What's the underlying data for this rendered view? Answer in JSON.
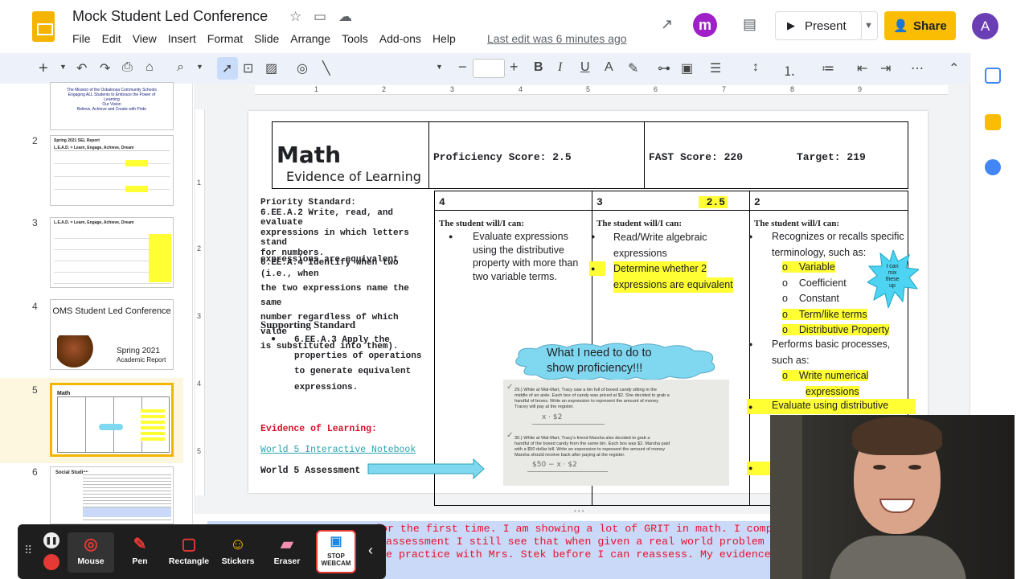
{
  "app": {
    "doc_title": "Mock Student Led Conference",
    "menu": [
      "File",
      "Edit",
      "View",
      "Insert",
      "Format",
      "Slide",
      "Arrange",
      "Tools",
      "Add-ons",
      "Help"
    ],
    "last_edit": "Last edit was 6 minutes ago",
    "present_label": "Present",
    "share_label": "Share",
    "avatar_initial": "A",
    "m_icon": "m"
  },
  "filmstrip": {
    "slides": [
      {
        "num": "",
        "lines": [
          "The Mission of the Oskaloosa Community Schools",
          "Engaging ALL Students to Embrace the Power of",
          "Learning",
          "Our Vision",
          "Believe, Achieve and Create with Pride"
        ]
      },
      {
        "num": "2",
        "title": "Spring 2021 SEL Report",
        "sub": "L.E.A.D. = Learn, Engage, Achieve, Dream"
      },
      {
        "num": "3",
        "title": "L.E.A.D. = Learn, Engage, Achieve, Dream"
      },
      {
        "num": "4",
        "title": "OMS Student Led Conference",
        "footer1": "Spring 2021",
        "footer2": "Academic Report"
      },
      {
        "num": "5",
        "title": "Math"
      },
      {
        "num": "6",
        "title": "Social Studies"
      }
    ]
  },
  "slide": {
    "title": "Math",
    "subtitle": "Evidence of Learning",
    "proficiency": "Proficiency Score: 2.5",
    "fast": "FAST Score:  220",
    "target": "Target:  219",
    "priority_header": "Priority Standard:",
    "priority_line1": "6.EE.A.2 Write, read, and evaluate",
    "priority_line2": "expressions in which letters stand",
    "priority_line3": "for numbers.",
    "priority_line4": "6.EE.A.4 Identify when two",
    "priority_line5": "expressions are equivalent (i.e., when",
    "priority_line6": "the two expressions name the same",
    "priority_line7": "number regardless of which value",
    "priority_line8": "is substituted into them).",
    "supporting_header": "Supporting Standard",
    "supporting_line1": "6.EE.A.3 Apply the",
    "supporting_line2": "properties of operations",
    "supporting_line3": "to generate equivalent",
    "supporting_line4": "expressions.",
    "evidence_label": "Evidence of Learning:",
    "link": "World 5 Interactive Notebook",
    "assessment": "World 5 Assessment",
    "col4_score": "4",
    "col3_score": "3",
    "col3_value": "2.5",
    "col2_score": "2",
    "can_label": "The student will/I can:",
    "col4_items": [
      "Evaluate expressions",
      "using the distributive",
      "property with more than",
      "two variable terms."
    ],
    "col3_item1a": "Read/Write algebraic",
    "col3_item1b": "expressions",
    "col3_item2a": "Determine whether 2",
    "col3_item2b": "expressions are equivalent",
    "col2_item1a": "Recognizes or recalls specific",
    "col2_item1b": "terminology, such as:",
    "col2_terms": [
      "Variable",
      "Coefficient",
      "Constant",
      "Term/like terms",
      "Distributive Property"
    ],
    "col2_item2a": "Performs basic processes,",
    "col2_item2b": "such as:",
    "col2_sub1a": "Write numerical",
    "col2_sub1b": "expressions",
    "col2_item3": "Evaluate using distributive",
    "starburst": [
      "I can",
      "mix",
      "these",
      "up"
    ],
    "cloud_line1": "What I need to do to",
    "cloud_line2": "show proficiency!!!",
    "scan_q29a": "29.)  While at Wal-Mart, Tracy saw a bin full of boxed candy sitting in the",
    "scan_q29b": "middle of an aisle. Each box of candy was priced at $2. She decided to grab a",
    "scan_q29c": "handful of boxes. Write an expression to represent the amount of money",
    "scan_q29d": "Tracey will pay at the register.",
    "scan_a29": "x · $2",
    "scan_q30a": "30.)  While at Wal-Mart, Tracy's friend Marsha also decided to grab a",
    "scan_q30b": "handful of the boxed candy from the same bin. Each box was $2. Marsha paid",
    "scan_q30c": "with a $50 dollar bill. Write an expression to represent the amount of money",
    "scan_q30d": "Marsha should receive back after paying at the register.",
    "scan_a30": "$50 − x · $2"
  },
  "notes": {
    "line1": "for the first time. I am showing a lot of GRIT in math. I complete my we",
    "line2": "assessment I still see that when given a real world problem I struggle t",
    "line3": "e practice with Mrs. Stek before I can reassess. My evidence of learni"
  },
  "annotation_bar": {
    "mouse": "Mouse",
    "pen": "Pen",
    "rectangle": "Rectangle",
    "stickers": "Stickers",
    "eraser": "Eraser",
    "stop1": "STOP",
    "stop2": "WEBCAM"
  },
  "ruler": {
    "h": [
      "1",
      "2",
      "3",
      "4",
      "5",
      "6",
      "7",
      "8",
      "9"
    ],
    "v": [
      "1",
      "2",
      "3",
      "4",
      "5"
    ]
  },
  "colors": {
    "accent": "#f4b400",
    "share": "#fbbc04",
    "highlight": "#ffff33",
    "notes_bg": "#c9d9f7",
    "notes_text": "#e8112d",
    "cloud": "#7fd8f0",
    "link": "#2aa3b0"
  }
}
